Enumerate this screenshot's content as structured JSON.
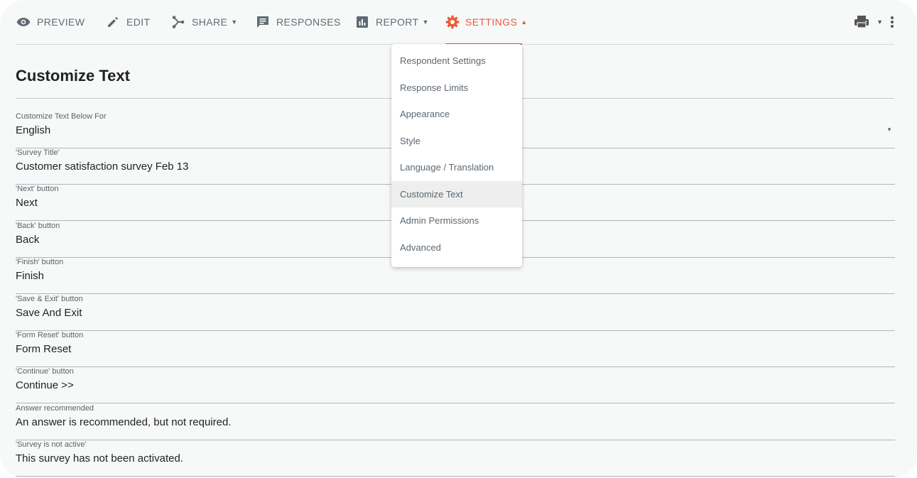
{
  "toolbar": {
    "tabs": [
      {
        "label": "PREVIEW",
        "icon": "eye-icon"
      },
      {
        "label": "EDIT",
        "icon": "pencil-icon"
      },
      {
        "label": "SHARE",
        "icon": "share-icon"
      },
      {
        "label": "RESPONSES",
        "icon": "responses-icon"
      },
      {
        "label": "REPORT",
        "icon": "report-icon"
      },
      {
        "label": "SETTINGS",
        "icon": "gear-icon"
      }
    ],
    "active_tab": "SETTINGS",
    "accent_color": "#ea5b3a"
  },
  "page": {
    "title": "Customize Text"
  },
  "fields": [
    {
      "label": "Customize Text Below For",
      "value": "English"
    },
    {
      "label": "'Survey Title'",
      "value": "Customer satisfaction survey Feb 13"
    },
    {
      "label": "'Next' button",
      "value": "Next"
    },
    {
      "label": "'Back' button",
      "value": "Back"
    },
    {
      "label": "'Finish' button",
      "value": "Finish"
    },
    {
      "label": "'Save & Exit' button",
      "value": "Save And Exit"
    },
    {
      "label": "'Form Reset' button",
      "value": "Form Reset"
    },
    {
      "label": "'Continue' button",
      "value": "Continue >>"
    },
    {
      "label": "Answer recommended",
      "value": "An answer is recommended, but not required."
    },
    {
      "label": "'Survey is not active'",
      "value": "This survey has not been activated."
    }
  ],
  "settings_menu": {
    "items": [
      "Respondent Settings",
      "Response Limits",
      "Appearance",
      "Style",
      "Language / Translation",
      "Customize Text",
      "Admin Permissions",
      "Advanced"
    ],
    "selected": "Customize Text"
  }
}
